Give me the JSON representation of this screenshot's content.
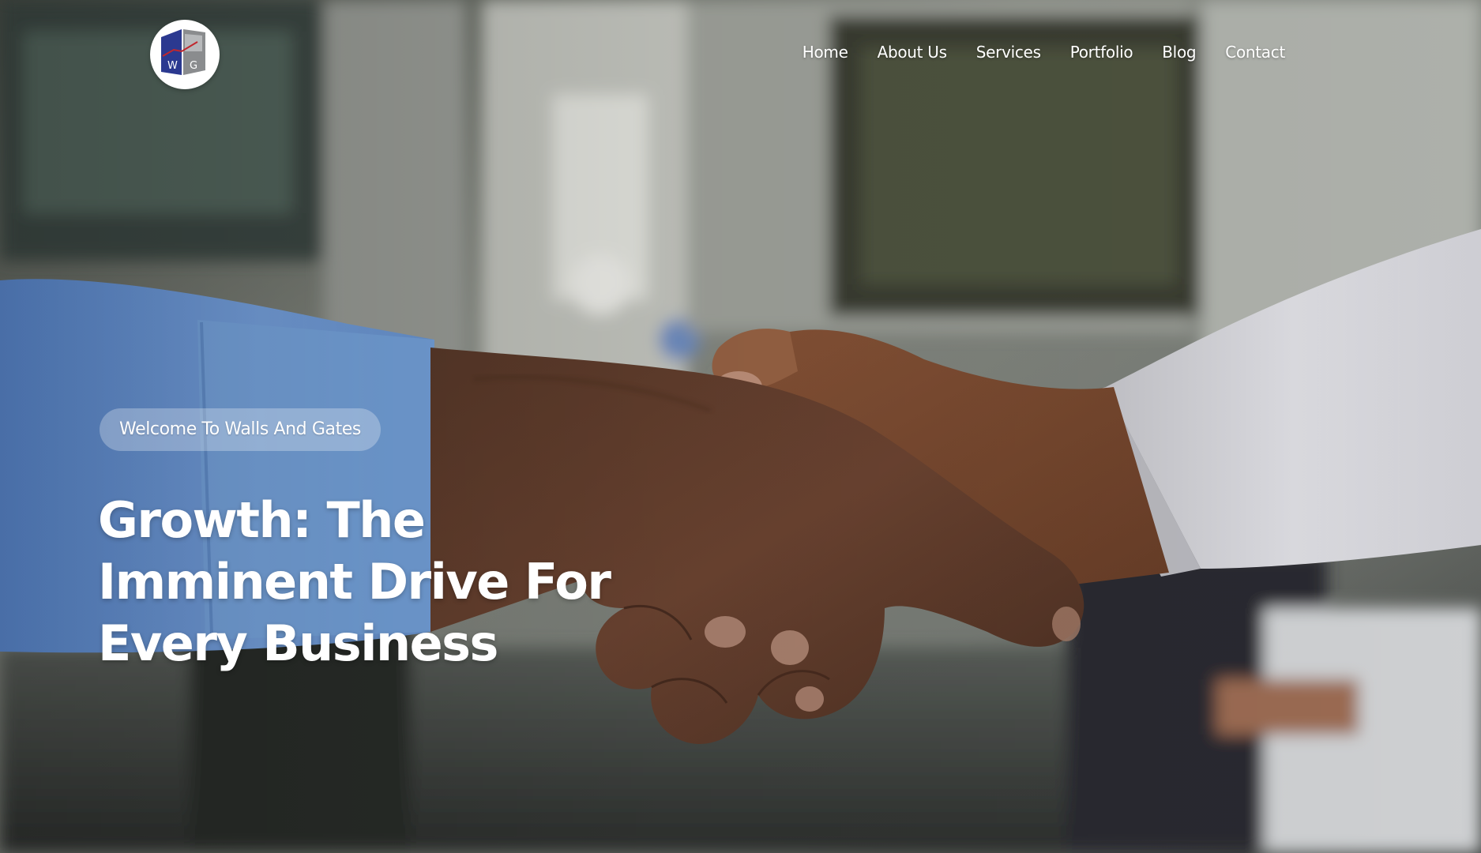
{
  "site": {
    "logo": {
      "letters": [
        "W",
        "G"
      ],
      "icon": "walls-and-gates-logo-icon"
    },
    "nav": {
      "items": [
        {
          "label": "Home"
        },
        {
          "label": "About Us"
        },
        {
          "label": "Services"
        },
        {
          "label": "Portfolio"
        },
        {
          "label": "Blog"
        },
        {
          "label": "Contact"
        }
      ]
    }
  },
  "hero": {
    "welcome_label": "Welcome To Walls And Gates",
    "headline_lines": [
      "Growth: The",
      "Imminent Drive For",
      "Every Business"
    ],
    "background_image": "handshake-photo",
    "colors": {
      "logo_blue": "#2b3990",
      "logo_gray": "#8a8c8e",
      "text": "#ffffff"
    }
  }
}
